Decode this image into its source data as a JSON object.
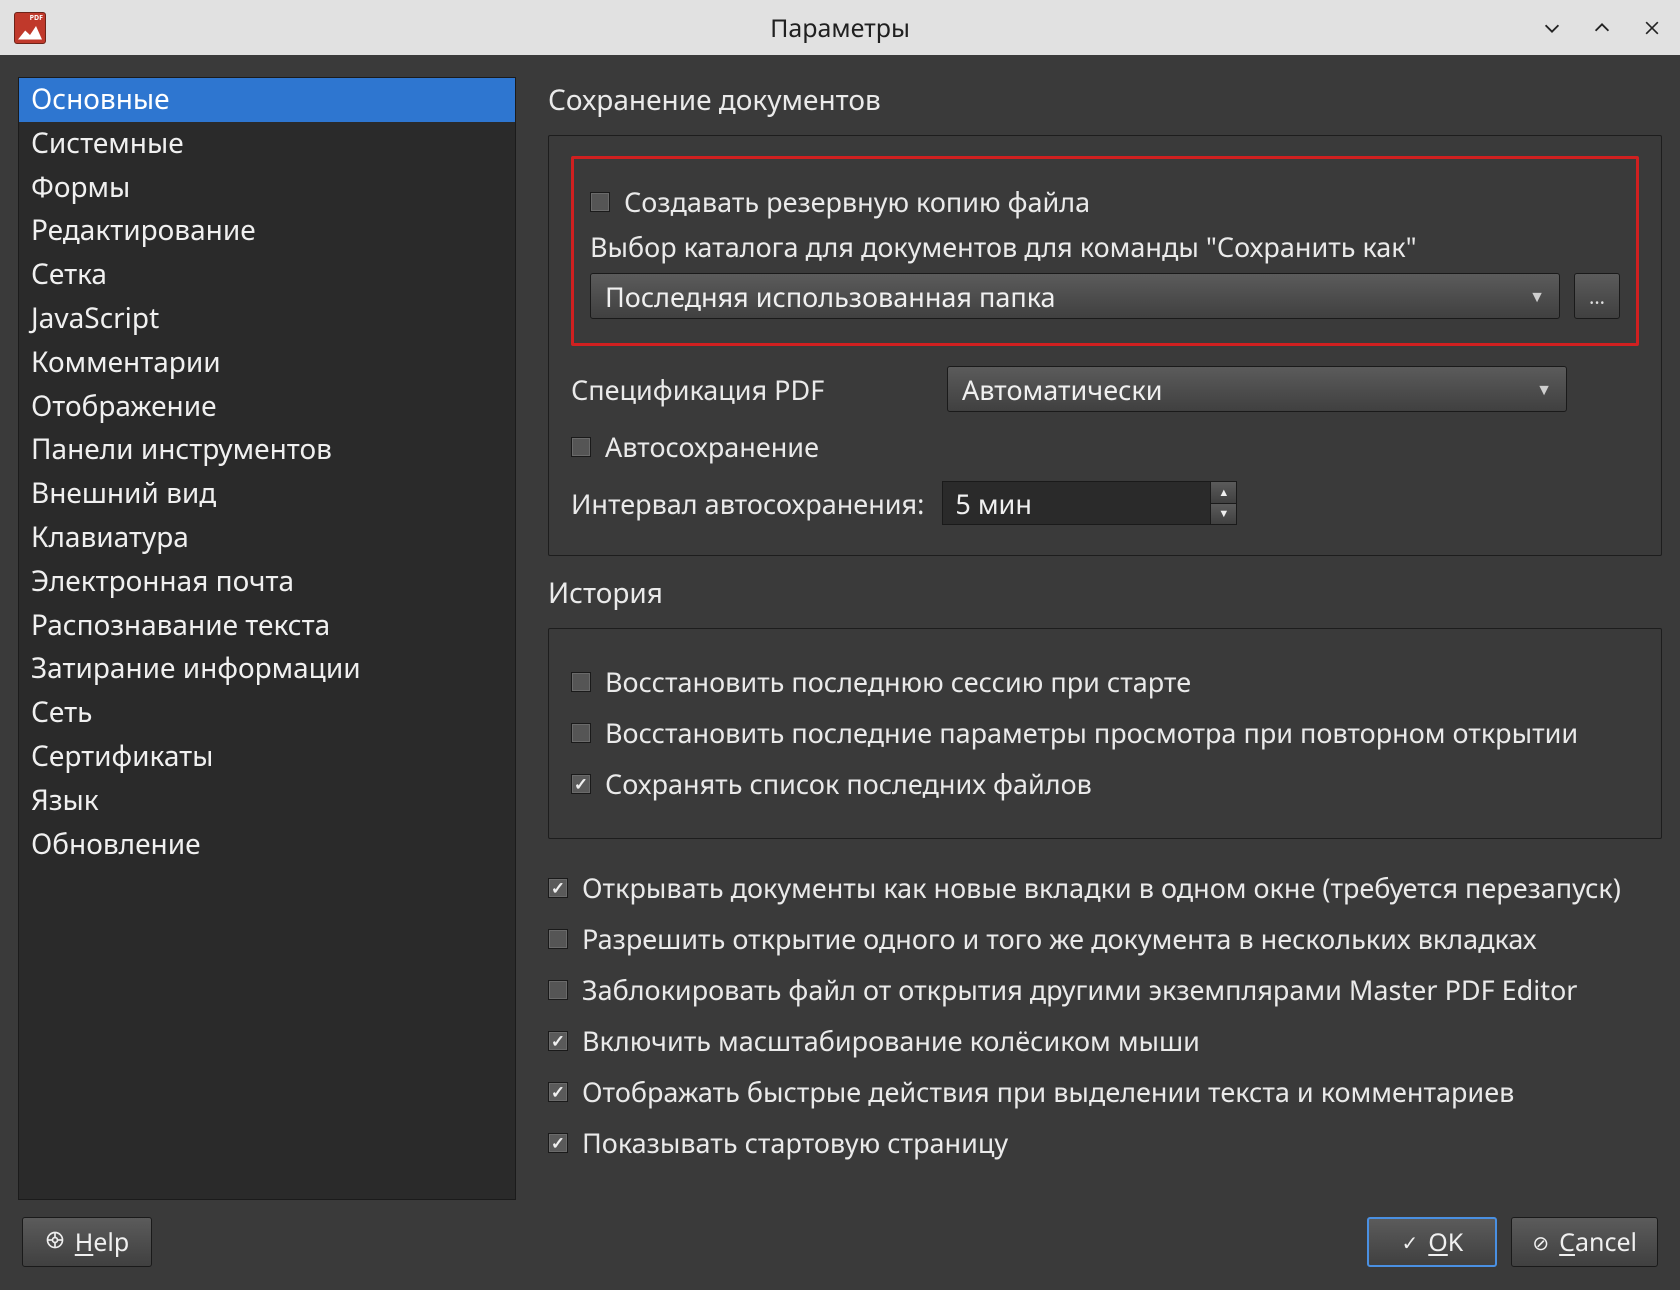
{
  "title": "Параметры",
  "sidebar": {
    "items": [
      "Основные",
      "Системные",
      "Формы",
      "Редактирование",
      "Сетка",
      "JavaScript",
      "Комментарии",
      "Отображение",
      "Панели инструментов",
      "Внешний вид",
      "Клавиатура",
      "Электронная почта",
      "Распознавание текста",
      "Затирание информации",
      "Сеть",
      "Сертификаты",
      "Язык",
      "Обновление"
    ],
    "selected_index": 0
  },
  "sections": {
    "save": {
      "title": "Сохранение документов",
      "backup_checkbox": "Создавать резервную копию файла",
      "folder_label": "Выбор каталога для документов для команды \"Сохранить как\"",
      "folder_combo": "Последняя использованная папка",
      "browse_btn": "...",
      "pdf_spec_label": "Спецификация PDF",
      "pdf_spec_value": "Автоматически",
      "autosave_checkbox": "Автосохранение",
      "autosave_interval_label": "Интервал автосохранения:",
      "autosave_interval_value": "5 мин"
    },
    "history": {
      "title": "История",
      "restore_session": "Восстановить последнюю сессию при старте",
      "restore_view": "Восстановить последние параметры просмотра при повторном открытии",
      "save_recent": "Сохранять список последних файлов"
    },
    "misc": {
      "open_tabs": "Открывать документы как новые вкладки в одном окне (требуется перезапуск)",
      "allow_multi": "Разрешить открытие одного и того же документа в нескольких вкладках",
      "lock_file": "Заблокировать файл от открытия другими экземплярами Master PDF Editor",
      "wheel_zoom": "Включить масштабирование колёсиком мыши",
      "quick_actions": "Отображать быстрые действия при выделении текста и комментариев",
      "start_page": "Показывать стартовую страницу"
    }
  },
  "footer": {
    "help": "Help",
    "ok": "OK",
    "cancel": "Cancel"
  }
}
